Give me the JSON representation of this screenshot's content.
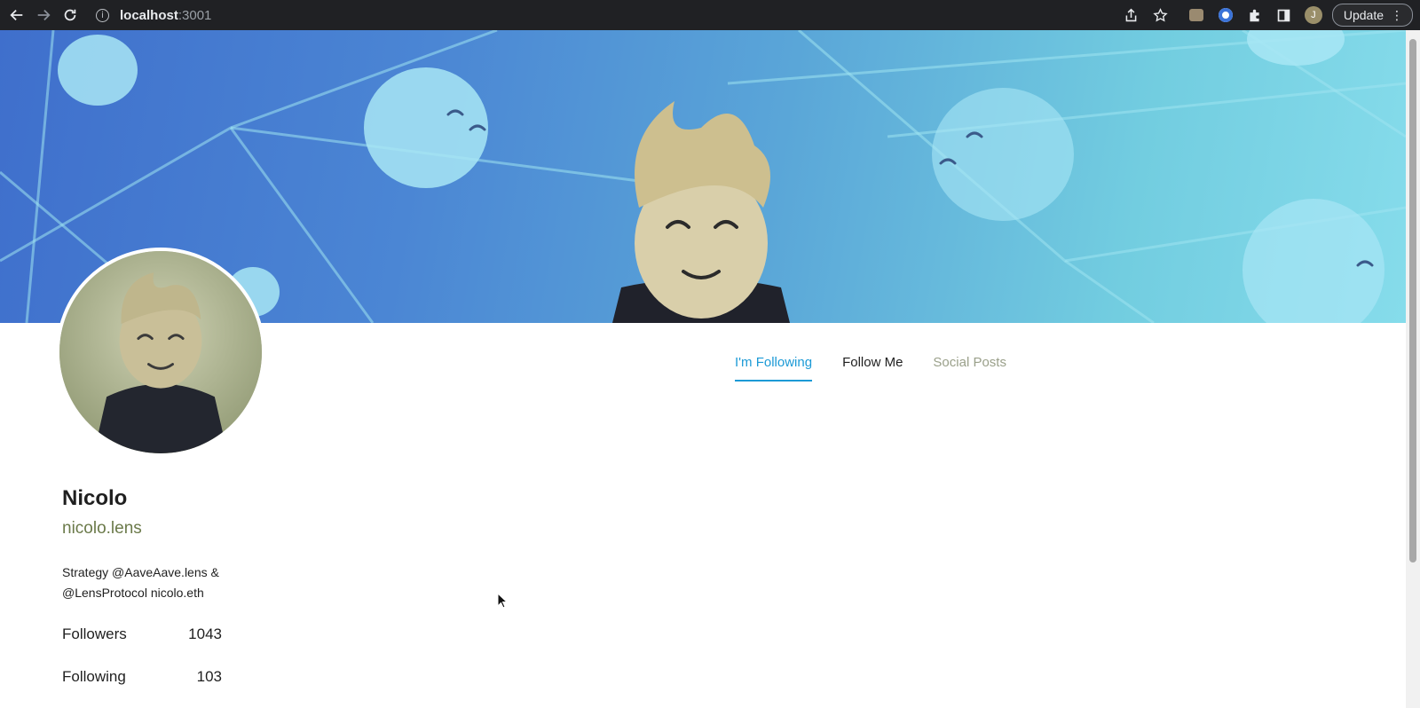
{
  "browser": {
    "url_host": "localhost",
    "url_port": ":3001",
    "profile_initial": "J",
    "update_label": "Update",
    "icons": [
      "back-icon",
      "forward-icon",
      "reload-icon",
      "info-icon",
      "share-icon",
      "star-icon",
      "fox-extension-icon",
      "circle-extension-icon",
      "puzzle-icon",
      "sidepanel-icon",
      "profile-avatar",
      "menu-dots-icon"
    ]
  },
  "profile": {
    "name": "Nicolo",
    "handle": "nicolo.lens",
    "bio": "Strategy @AaveAave.lens & @LensProtocol nicolo.eth",
    "stats": {
      "followers_label": "Followers",
      "followers_value": "1043",
      "following_label": "Following",
      "following_value": "103"
    }
  },
  "tabs": [
    {
      "label": "I'm Following",
      "state": "active"
    },
    {
      "label": "Follow Me",
      "state": "normal"
    },
    {
      "label": "Social Posts",
      "state": "muted"
    }
  ],
  "colors": {
    "accent": "#1c9ad6",
    "handle": "#6b7a4a",
    "chrome_bg": "#202124"
  }
}
